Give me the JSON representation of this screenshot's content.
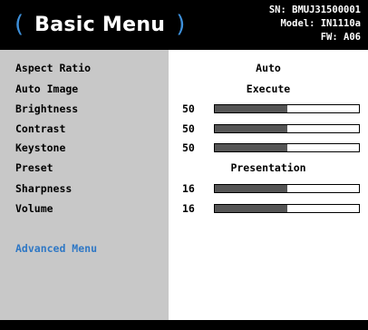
{
  "header": {
    "title": "Basic Menu",
    "paren_open": "(",
    "paren_close": ")",
    "sn": "SN: BMUJ31500001",
    "model": "Model: IN1110a",
    "fw": "FW: A06"
  },
  "items": [
    {
      "label": "Aspect Ratio",
      "value": "Auto"
    },
    {
      "label": "Auto Image",
      "value": "Execute"
    },
    {
      "label": "Brightness",
      "number": "50",
      "level": 0.5
    },
    {
      "label": "Contrast",
      "number": "50",
      "level": 0.5
    },
    {
      "label": "Keystone",
      "number": "50",
      "level": 0.5
    },
    {
      "label": "Preset",
      "value": "Presentation"
    },
    {
      "label": "Sharpness",
      "number": "16",
      "level": 0.5
    },
    {
      "label": "Volume",
      "number": "16",
      "level": 0.5
    }
  ],
  "advanced": {
    "label": "Advanced Menu"
  },
  "colors": {
    "accent": "#3d8fd9",
    "link": "#2f78c5",
    "header_bg": "#000000",
    "left_bg": "#c8c8c8",
    "bar_fill": "#555555"
  }
}
